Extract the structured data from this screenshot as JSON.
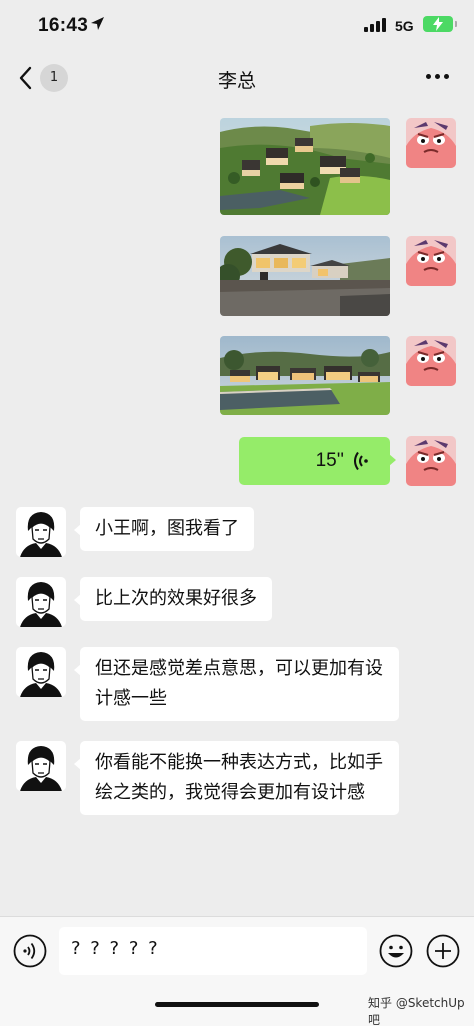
{
  "status_bar": {
    "time": "16:43",
    "network": "5G"
  },
  "header": {
    "unread_count": "1",
    "title": "李总"
  },
  "messages": {
    "voice_duration": "15''",
    "received": [
      "小王啊，图我看了",
      "比上次的效果好很多",
      "但还是感觉差点意思，可以更加有设计感一些",
      "你看能不能换一种表达方式，比如手绘之类的，我觉得会更加有设计感"
    ]
  },
  "input": {
    "value": "? ? ? ? ?"
  },
  "watermark": "知乎 @SketchUp吧",
  "colors": {
    "outgoing_bubble": "#95ec69",
    "background": "#ededed",
    "battery": "#4cd964"
  }
}
